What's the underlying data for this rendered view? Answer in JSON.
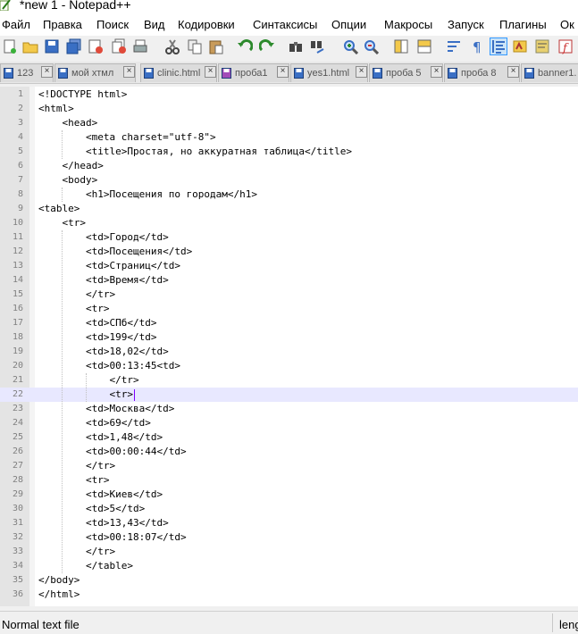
{
  "window": {
    "title": "*new 1 - Notepad++"
  },
  "menu": {
    "items": [
      {
        "label": "Файл"
      },
      {
        "label": "Правка"
      },
      {
        "label": "Поиск"
      },
      {
        "label": "Вид"
      },
      {
        "label": "Кодировки"
      },
      {
        "label": "Синтаксисы"
      },
      {
        "label": "Опции"
      },
      {
        "label": "Макросы"
      },
      {
        "label": "Запуск"
      },
      {
        "label": "Плагины"
      },
      {
        "label": "Ок"
      }
    ]
  },
  "toolbar": {
    "buttons": [
      {
        "icon": "new-file-icon"
      },
      {
        "icon": "open-file-icon"
      },
      {
        "icon": "save-icon"
      },
      {
        "icon": "save-all-icon"
      },
      {
        "icon": "close-icon"
      },
      {
        "icon": "close-all-icon"
      },
      {
        "icon": "print-icon"
      },
      {
        "icon": "cut-icon"
      },
      {
        "icon": "copy-icon"
      },
      {
        "icon": "paste-icon"
      },
      {
        "icon": "undo-icon"
      },
      {
        "icon": "redo-icon"
      },
      {
        "icon": "find-icon"
      },
      {
        "icon": "replace-icon"
      },
      {
        "icon": "zoom-in-icon"
      },
      {
        "icon": "zoom-out-icon"
      },
      {
        "icon": "sync-vertical-icon"
      },
      {
        "icon": "sync-horizontal-icon"
      },
      {
        "icon": "word-wrap-icon"
      },
      {
        "icon": "show-all-chars-icon"
      },
      {
        "icon": "indent-guide-icon"
      },
      {
        "icon": "user-language-icon"
      },
      {
        "icon": "doc-map-icon"
      },
      {
        "icon": "function-list-icon"
      }
    ],
    "active_icon": "indent-guide-icon"
  },
  "tabs": [
    {
      "label": "123",
      "active": false
    },
    {
      "label": "мой хтмл",
      "active": false
    },
    {
      "label": "clinic.html",
      "active": false
    },
    {
      "label": "проба1",
      "active": false
    },
    {
      "label": "yes1.html",
      "active": false
    },
    {
      "label": "проба 5",
      "active": false
    },
    {
      "label": "проба 8",
      "active": false
    },
    {
      "label": "banner1.",
      "active": false
    }
  ],
  "editor": {
    "current_line": 22,
    "lines": [
      "<!DOCTYPE html>",
      "<html>",
      "    <head>",
      "        <meta charset=\"utf-8\">",
      "        <title>Простая, но аккуратная таблица</title>",
      "    </head>",
      "    <body>",
      "        <h1>Посещения по городам</h1>",
      "<table>",
      "    <tr>",
      "        <td>Город</td>",
      "        <td>Посещения</td>",
      "        <td>Страниц</td>",
      "        <td>Время</td>",
      "        </tr>",
      "        <tr>",
      "        <td>СПб</td>",
      "        <td>199</td>",
      "        <td>18,02</td>",
      "        <td>00:13:45<td>",
      "            </tr>",
      "            <tr>",
      "        <td>Москва</td>",
      "        <td>69</td>",
      "        <td>1,48</td>",
      "        <td>00:00:44</td>",
      "        </tr>",
      "        <tr>",
      "        <td>Киев</td>",
      "        <td>5</td>",
      "        <td>13,43</td>",
      "        <td>00:18:07</td>",
      "        </tr>",
      "        </table>",
      "</body>",
      "</html>"
    ]
  },
  "status": {
    "file_type": "Normal text file",
    "length_label": "leng"
  }
}
